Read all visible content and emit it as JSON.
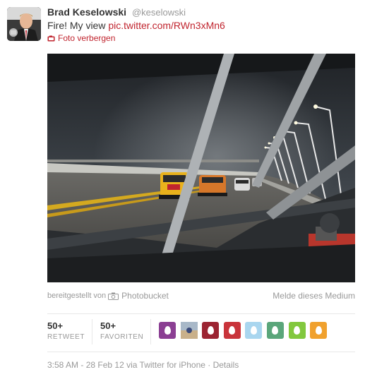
{
  "tweet": {
    "fullname": "Brad Keselowski",
    "username": "@keselowski",
    "text_prefix": "Fire! My view ",
    "link": "pic.twitter.com/RWn3xMn6",
    "hide_photo": "Foto verbergen"
  },
  "media": {
    "provided_by_label": "bereitgestellt von",
    "provider": "Photobucket",
    "report_link": "Melde dieses Medium"
  },
  "stats": {
    "retweets_count": "50+",
    "retweets_label": "RETWEET",
    "favorites_count": "50+",
    "favorites_label": "FAVORITEN"
  },
  "favoriters": [
    {
      "color": "#8b3f93",
      "icon": "egg-avatar"
    },
    {
      "color": "#9aa7b4",
      "icon": "photo-avatar"
    },
    {
      "color": "#9c2432",
      "icon": "egg-avatar"
    },
    {
      "color": "#c9343b",
      "icon": "egg-avatar"
    },
    {
      "color": "#a9d6ef",
      "icon": "egg-avatar"
    },
    {
      "color": "#5aa67a",
      "icon": "egg-avatar"
    },
    {
      "color": "#82c83e",
      "icon": "egg-avatar"
    },
    {
      "color": "#f0a12e",
      "icon": "egg-avatar"
    }
  ],
  "meta": {
    "time": "3:58 AM",
    "separator1": " - ",
    "date": "28 Feb 12",
    "via_text": " via Twitter for iPhone",
    "separator2": " · ",
    "details": "Details"
  },
  "colors": {
    "link": "#c0242e",
    "muted": "#999999"
  }
}
